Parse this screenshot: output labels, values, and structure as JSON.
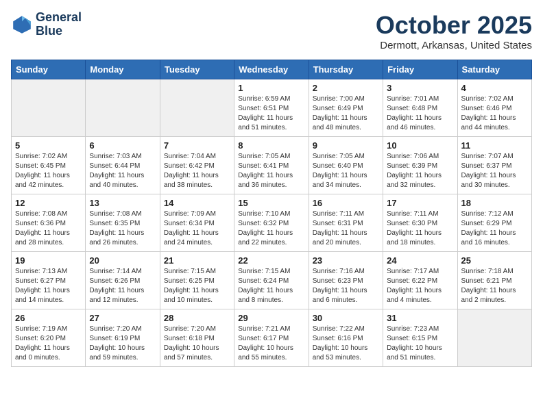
{
  "header": {
    "logo_line1": "General",
    "logo_line2": "Blue",
    "month": "October 2025",
    "location": "Dermott, Arkansas, United States"
  },
  "weekdays": [
    "Sunday",
    "Monday",
    "Tuesday",
    "Wednesday",
    "Thursday",
    "Friday",
    "Saturday"
  ],
  "weeks": [
    [
      {
        "day": "",
        "info": ""
      },
      {
        "day": "",
        "info": ""
      },
      {
        "day": "",
        "info": ""
      },
      {
        "day": "1",
        "info": "Sunrise: 6:59 AM\nSunset: 6:51 PM\nDaylight: 11 hours\nand 51 minutes."
      },
      {
        "day": "2",
        "info": "Sunrise: 7:00 AM\nSunset: 6:49 PM\nDaylight: 11 hours\nand 48 minutes."
      },
      {
        "day": "3",
        "info": "Sunrise: 7:01 AM\nSunset: 6:48 PM\nDaylight: 11 hours\nand 46 minutes."
      },
      {
        "day": "4",
        "info": "Sunrise: 7:02 AM\nSunset: 6:46 PM\nDaylight: 11 hours\nand 44 minutes."
      }
    ],
    [
      {
        "day": "5",
        "info": "Sunrise: 7:02 AM\nSunset: 6:45 PM\nDaylight: 11 hours\nand 42 minutes."
      },
      {
        "day": "6",
        "info": "Sunrise: 7:03 AM\nSunset: 6:44 PM\nDaylight: 11 hours\nand 40 minutes."
      },
      {
        "day": "7",
        "info": "Sunrise: 7:04 AM\nSunset: 6:42 PM\nDaylight: 11 hours\nand 38 minutes."
      },
      {
        "day": "8",
        "info": "Sunrise: 7:05 AM\nSunset: 6:41 PM\nDaylight: 11 hours\nand 36 minutes."
      },
      {
        "day": "9",
        "info": "Sunrise: 7:05 AM\nSunset: 6:40 PM\nDaylight: 11 hours\nand 34 minutes."
      },
      {
        "day": "10",
        "info": "Sunrise: 7:06 AM\nSunset: 6:39 PM\nDaylight: 11 hours\nand 32 minutes."
      },
      {
        "day": "11",
        "info": "Sunrise: 7:07 AM\nSunset: 6:37 PM\nDaylight: 11 hours\nand 30 minutes."
      }
    ],
    [
      {
        "day": "12",
        "info": "Sunrise: 7:08 AM\nSunset: 6:36 PM\nDaylight: 11 hours\nand 28 minutes."
      },
      {
        "day": "13",
        "info": "Sunrise: 7:08 AM\nSunset: 6:35 PM\nDaylight: 11 hours\nand 26 minutes."
      },
      {
        "day": "14",
        "info": "Sunrise: 7:09 AM\nSunset: 6:34 PM\nDaylight: 11 hours\nand 24 minutes."
      },
      {
        "day": "15",
        "info": "Sunrise: 7:10 AM\nSunset: 6:32 PM\nDaylight: 11 hours\nand 22 minutes."
      },
      {
        "day": "16",
        "info": "Sunrise: 7:11 AM\nSunset: 6:31 PM\nDaylight: 11 hours\nand 20 minutes."
      },
      {
        "day": "17",
        "info": "Sunrise: 7:11 AM\nSunset: 6:30 PM\nDaylight: 11 hours\nand 18 minutes."
      },
      {
        "day": "18",
        "info": "Sunrise: 7:12 AM\nSunset: 6:29 PM\nDaylight: 11 hours\nand 16 minutes."
      }
    ],
    [
      {
        "day": "19",
        "info": "Sunrise: 7:13 AM\nSunset: 6:27 PM\nDaylight: 11 hours\nand 14 minutes."
      },
      {
        "day": "20",
        "info": "Sunrise: 7:14 AM\nSunset: 6:26 PM\nDaylight: 11 hours\nand 12 minutes."
      },
      {
        "day": "21",
        "info": "Sunrise: 7:15 AM\nSunset: 6:25 PM\nDaylight: 11 hours\nand 10 minutes."
      },
      {
        "day": "22",
        "info": "Sunrise: 7:15 AM\nSunset: 6:24 PM\nDaylight: 11 hours\nand 8 minutes."
      },
      {
        "day": "23",
        "info": "Sunrise: 7:16 AM\nSunset: 6:23 PM\nDaylight: 11 hours\nand 6 minutes."
      },
      {
        "day": "24",
        "info": "Sunrise: 7:17 AM\nSunset: 6:22 PM\nDaylight: 11 hours\nand 4 minutes."
      },
      {
        "day": "25",
        "info": "Sunrise: 7:18 AM\nSunset: 6:21 PM\nDaylight: 11 hours\nand 2 minutes."
      }
    ],
    [
      {
        "day": "26",
        "info": "Sunrise: 7:19 AM\nSunset: 6:20 PM\nDaylight: 11 hours\nand 0 minutes."
      },
      {
        "day": "27",
        "info": "Sunrise: 7:20 AM\nSunset: 6:19 PM\nDaylight: 10 hours\nand 59 minutes."
      },
      {
        "day": "28",
        "info": "Sunrise: 7:20 AM\nSunset: 6:18 PM\nDaylight: 10 hours\nand 57 minutes."
      },
      {
        "day": "29",
        "info": "Sunrise: 7:21 AM\nSunset: 6:17 PM\nDaylight: 10 hours\nand 55 minutes."
      },
      {
        "day": "30",
        "info": "Sunrise: 7:22 AM\nSunset: 6:16 PM\nDaylight: 10 hours\nand 53 minutes."
      },
      {
        "day": "31",
        "info": "Sunrise: 7:23 AM\nSunset: 6:15 PM\nDaylight: 10 hours\nand 51 minutes."
      },
      {
        "day": "",
        "info": ""
      }
    ]
  ]
}
